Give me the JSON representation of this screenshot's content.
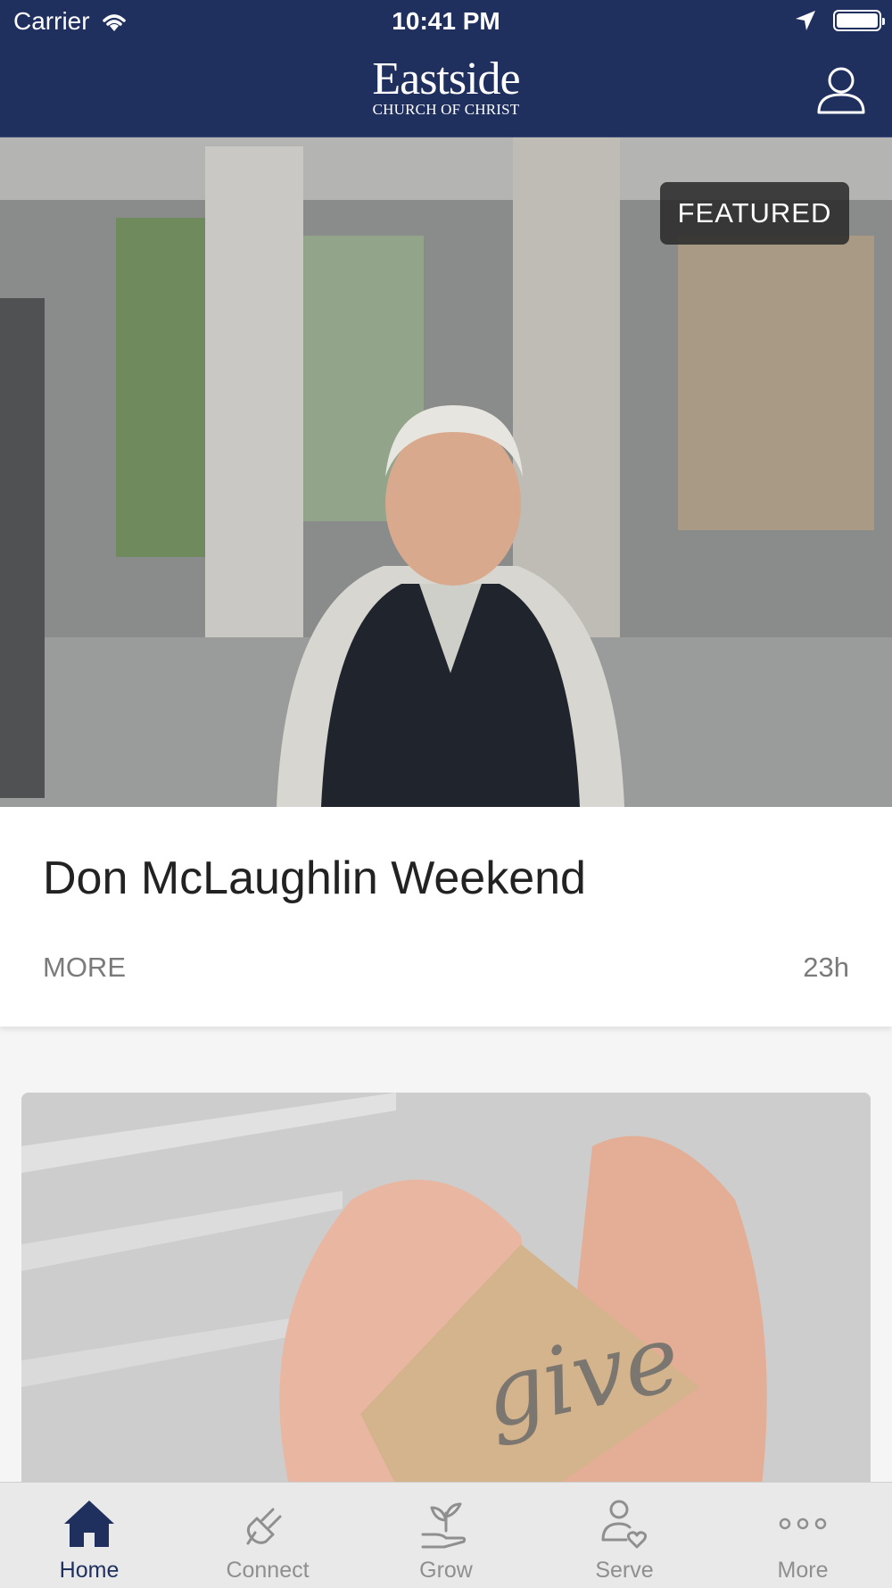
{
  "status_bar": {
    "carrier": "Carrier",
    "time": "10:41 PM"
  },
  "header": {
    "logo_name": "Eastside",
    "logo_sub": "CHURCH OF CHRIST",
    "profile_icon": "person-icon"
  },
  "featured": {
    "badge": "FEATURED",
    "title": "Don McLaughlin Weekend",
    "more": "MORE",
    "age": "23h"
  },
  "give_card": {
    "word": "give"
  },
  "tabs": [
    {
      "label": "Home",
      "icon": "home-icon",
      "active": true
    },
    {
      "label": "Connect",
      "icon": "plug-icon",
      "active": false
    },
    {
      "label": "Grow",
      "icon": "plant-hand-icon",
      "active": false
    },
    {
      "label": "Serve",
      "icon": "person-heart-icon",
      "active": false
    },
    {
      "label": "More",
      "icon": "more-dots-icon",
      "active": false
    }
  ],
  "colors": {
    "brand_navy": "#1f2f5e",
    "tab_inactive": "#8f8f8f",
    "page_bg": "#f5f5f5"
  }
}
